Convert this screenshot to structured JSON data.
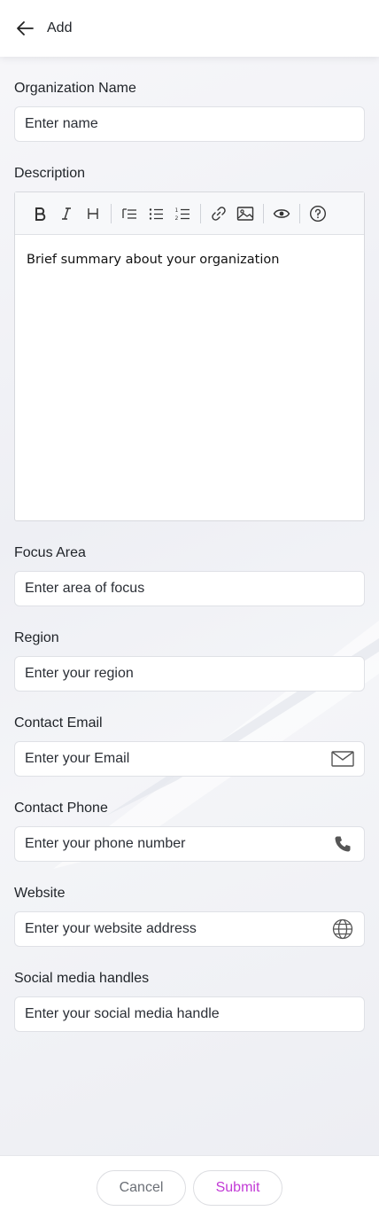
{
  "header": {
    "title": "Add"
  },
  "fields": {
    "org_name": {
      "label": "Organization Name",
      "placeholder": "Enter name"
    },
    "description": {
      "label": "Description",
      "content": "Brief summary about your organization"
    },
    "focus_area": {
      "label": "Focus Area",
      "placeholder": "Enter area of focus"
    },
    "region": {
      "label": "Region",
      "placeholder": "Enter your region"
    },
    "email": {
      "label": "Contact Email",
      "placeholder": "Enter your Email",
      "icon": "mail-icon"
    },
    "phone": {
      "label": "Contact Phone",
      "placeholder": "Enter your phone number",
      "icon": "phone-icon"
    },
    "website": {
      "label": "Website",
      "placeholder": "Enter your website address",
      "icon": "globe-icon"
    },
    "social": {
      "label": "Social media handles",
      "placeholder": "Enter your social media handle"
    }
  },
  "toolbar": {
    "items": [
      "bold",
      "italic",
      "heading",
      "indent-list",
      "bullet-list",
      "numbered-list",
      "link",
      "image",
      "preview",
      "help"
    ]
  },
  "footer": {
    "cancel_label": "Cancel",
    "submit_label": "Submit"
  },
  "colors": {
    "accent": "#c23ad6",
    "background": "#f2f3f7",
    "border": "#dfe1e6"
  }
}
